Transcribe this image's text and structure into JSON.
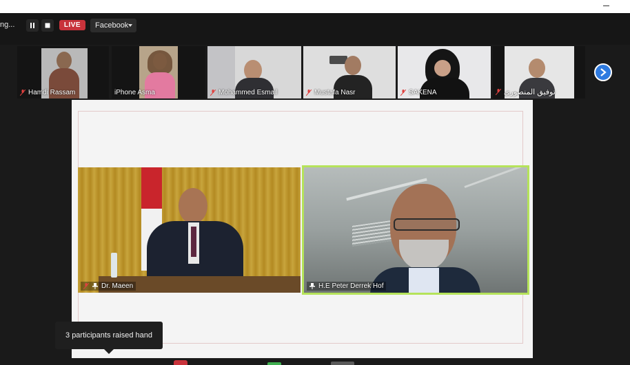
{
  "toolbar": {
    "recording_text": "ng...",
    "pause_icon": "pause-icon",
    "stop_icon": "stop-icon",
    "live_badge": "LIVE",
    "stream_target": "Facebook"
  },
  "participants": [
    {
      "name": "Hamdi Rassam"
    },
    {
      "name": "iPhone Asma"
    },
    {
      "name": "Mohammed Esmail"
    },
    {
      "name": "Mustafa Nasr"
    },
    {
      "name": "SAKENA"
    },
    {
      "name": "توفيق المنصوري"
    }
  ],
  "stage": {
    "left_video_name": "Dr. Maeen",
    "right_video_name": "H.E Peter Derrek Hof",
    "active_speaker_color": "#b5e35a"
  },
  "tooltip": {
    "text": "3 participants raised hand"
  },
  "colors": {
    "live": "#c8333b",
    "accent_blue": "#2e7ae0",
    "mic_off": "#e0413f"
  }
}
